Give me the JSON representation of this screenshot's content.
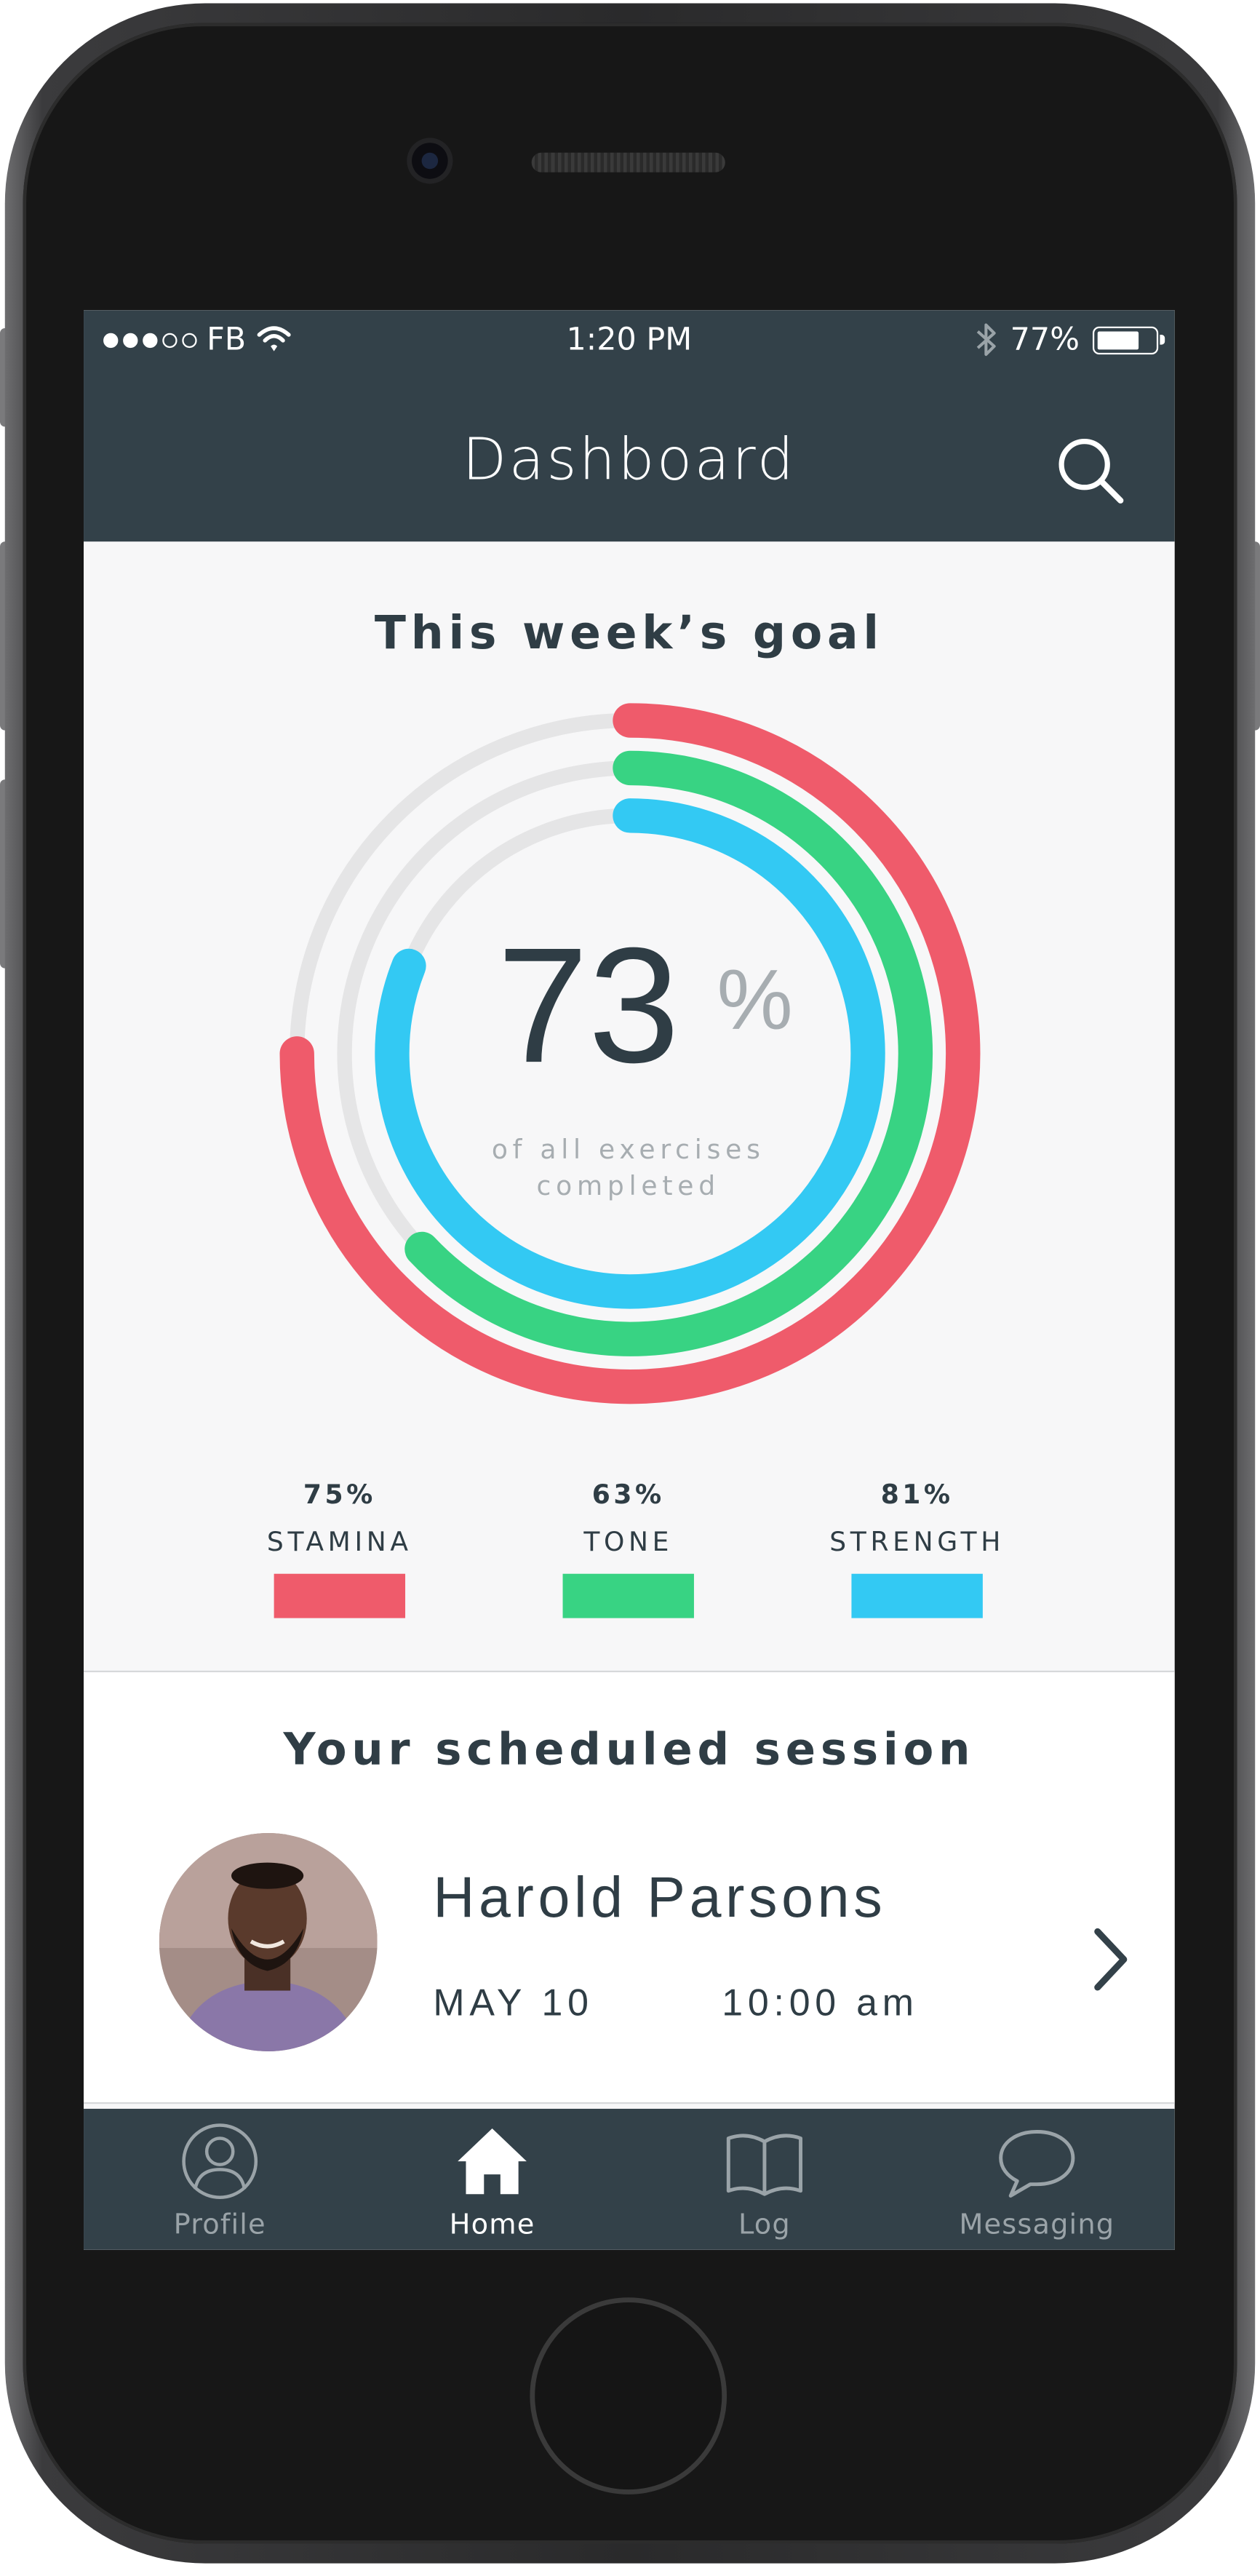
{
  "status_bar": {
    "carrier": "FB",
    "time": "1:20 PM",
    "battery": "77%",
    "battery_level": 0.77,
    "signal_bars": 3
  },
  "header": {
    "title": "Dashboard",
    "search_icon": "search-icon"
  },
  "goal": {
    "title": "This week’s goal",
    "total_percent": "73",
    "percent_sign": "%",
    "caption_line1": "of all exercises",
    "caption_line2": "completed",
    "metrics": [
      {
        "label": "STAMINA",
        "percent": "75%",
        "value": 0.75,
        "color": "#ef5b6b"
      },
      {
        "label": "TONE",
        "percent": "63%",
        "value": 0.63,
        "color": "#38d383"
      },
      {
        "label": "STRENGTH",
        "percent": "81%",
        "value": 0.81,
        "color": "#33c9f3"
      }
    ],
    "track_color": "#e5e5e6"
  },
  "session": {
    "title": "Your scheduled session",
    "trainer": "Harold Parsons",
    "date": "MAY 10",
    "time": "10:00 am",
    "chevron_icon": "chevron-right-icon"
  },
  "tabs": [
    {
      "label": "Profile",
      "icon": "profile-icon",
      "active": false
    },
    {
      "label": "Home",
      "icon": "home-icon",
      "active": true
    },
    {
      "label": "Log",
      "icon": "book-icon",
      "active": false
    },
    {
      "label": "Messaging",
      "icon": "chat-bubble-icon",
      "active": false
    }
  ],
  "colors": {
    "header_bg": "#334149",
    "text_dark": "#2f3d45",
    "text_muted": "#a7adb1",
    "tab_inactive": "#9aa3a8",
    "tab_active": "#ffffff"
  }
}
